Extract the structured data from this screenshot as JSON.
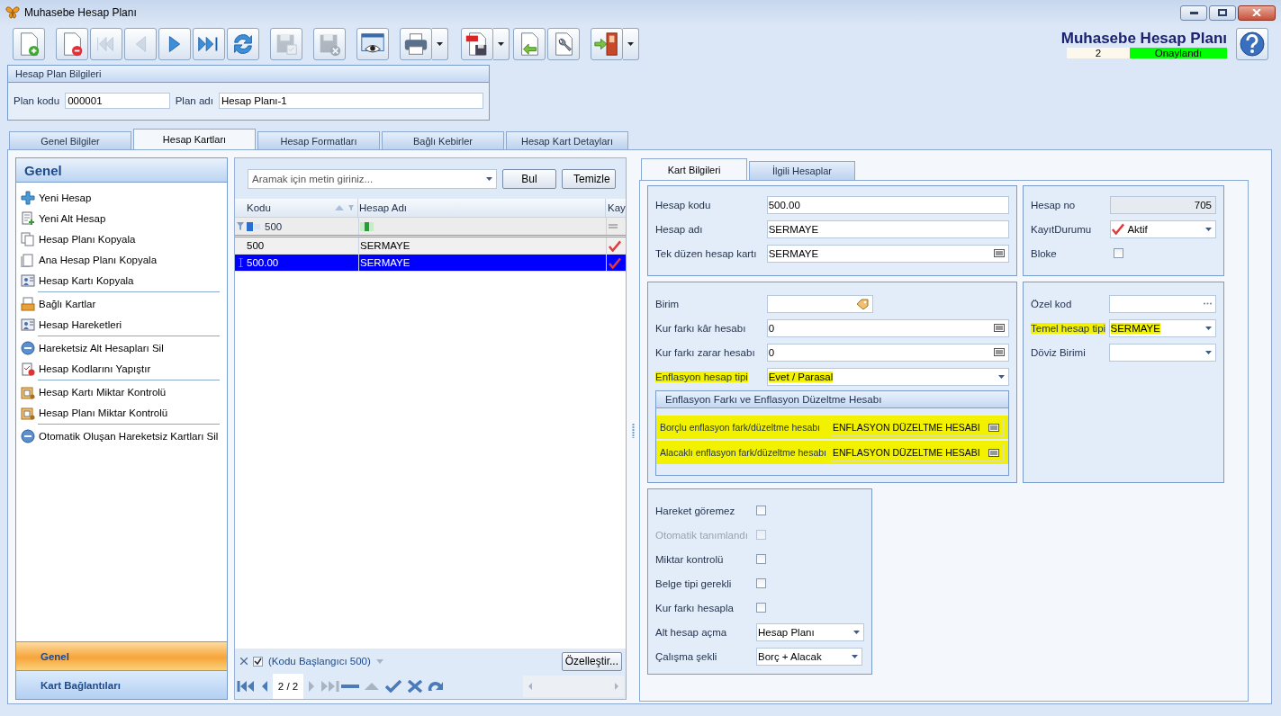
{
  "window": {
    "title": "Muhasebe Hesap Planı"
  },
  "toolbar": [
    {
      "kind": "new",
      "disabled": false
    },
    {
      "kind": "delete",
      "disabled": false
    },
    {
      "kind": "first",
      "disabled": true
    },
    {
      "kind": "prev",
      "disabled": true
    },
    {
      "kind": "next",
      "disabled": false
    },
    {
      "kind": "last",
      "disabled": false
    },
    {
      "kind": "refresh",
      "disabled": false
    },
    {
      "kind": "save",
      "disabled": true
    },
    {
      "kind": "cancel",
      "disabled": true
    },
    {
      "kind": "preview",
      "disabled": false
    },
    {
      "kind": "print",
      "disabled": false
    },
    {
      "kind": "pdf",
      "disabled": false
    },
    {
      "kind": "import",
      "disabled": false
    },
    {
      "kind": "tools",
      "disabled": false
    },
    {
      "kind": "exit",
      "disabled": false
    }
  ],
  "header": {
    "title": "Muhasebe Hesap Planı",
    "number": "2",
    "status": "Onaylandı"
  },
  "plan_info": {
    "title": "Hesap Plan Bilgileri",
    "fields": [
      {
        "label": "Plan kodu",
        "value": "000001"
      },
      {
        "label": "Plan adı",
        "value": "Hesap Planı-1"
      }
    ]
  },
  "tabs": [
    {
      "label": "Genel Bilgiler",
      "selected": false
    },
    {
      "label": "Hesap Kartları",
      "selected": true
    },
    {
      "label": "Hesap Formatları",
      "selected": false
    },
    {
      "label": "Bağlı Kebirler",
      "selected": false
    },
    {
      "label": "Hesap Kart Detayları",
      "selected": false
    }
  ],
  "sidebar": {
    "title": "Genel",
    "groups": [
      [
        {
          "label": "Yeni Hesap",
          "kind": "plus"
        },
        {
          "label": "Yeni Alt Hesap",
          "kind": "docplus"
        },
        {
          "label": "Hesap Planı Kopyala",
          "kind": "copy"
        },
        {
          "label": "Ana Hesap Planı Kopyala",
          "kind": "page"
        },
        {
          "label": "Hesap Kartı Kopyala",
          "kind": "card"
        }
      ],
      [
        {
          "label": "Bağlı Kartlar",
          "kind": "tray"
        },
        {
          "label": "Hesap Hareketleri",
          "kind": "card"
        }
      ],
      [
        {
          "label": "Hareketsiz Alt Hesapları Sil",
          "kind": "minus"
        },
        {
          "label": "Hesap Kodlarını Yapıştır",
          "kind": "clipboard"
        }
      ],
      [
        {
          "label": "Hesap Kartı Miktar Kontrolü",
          "kind": "box"
        },
        {
          "label": "Hesap Planı Miktar Kontrolü",
          "kind": "box"
        }
      ],
      [
        {
          "label": "Otomatik Oluşan Hareketsiz Kartları Sil",
          "kind": "minus"
        }
      ]
    ],
    "sections": [
      {
        "label": "Genel",
        "selected": true
      },
      {
        "label": "Kart Bağlantıları",
        "selected": false
      }
    ]
  },
  "grid": {
    "search": {
      "placeholder": "Aramak için metin giriniz..."
    },
    "buttons": [
      "Bul",
      "Temizle"
    ],
    "columns": [
      "Kodu",
      "Hesap Adı",
      "Kay"
    ],
    "filter": {
      "value": "500"
    },
    "rows": [
      {
        "cells": [
          "500",
          "SERMAYE"
        ],
        "checked": true,
        "selected": false
      },
      {
        "cells": [
          "500.00",
          "SERMAYE"
        ],
        "checked": true,
        "selected": true
      }
    ],
    "filter_bar": {
      "enabled": true,
      "text": "(Kodu Başlangıcı 500)"
    },
    "customize": "Özelleştir...",
    "navigator": {
      "position": "2 / 2"
    }
  },
  "detail": {
    "tabs": [
      {
        "label": "Kart Bilgileri",
        "selected": true
      },
      {
        "label": "İlgili Hesaplar",
        "selected": false
      }
    ],
    "main_fields": [
      {
        "label": "Hesap kodu",
        "value": "500.00",
        "kind": "text"
      },
      {
        "label": "Hesap adı",
        "value": "SERMAYE",
        "kind": "text"
      },
      {
        "label": "Tek düzen hesap kartı",
        "value": "SERMAYE",
        "kind": "lookup"
      }
    ],
    "status_fields": [
      {
        "label": "Hesap no",
        "value": "705",
        "kind": "readonly"
      },
      {
        "label": "KayıtDurumu",
        "value": "Aktif",
        "kind": "status"
      },
      {
        "label": "Bloke",
        "kind": "checkbox",
        "checked": false
      }
    ],
    "currency_fields": [
      {
        "label": "Birim",
        "kind": "tag"
      },
      {
        "label": "Kur farkı kâr hesabı",
        "value": "0",
        "kind": "lookup"
      },
      {
        "label": "Kur farkı zarar hesabı",
        "value": "0",
        "kind": "lookup"
      },
      {
        "label": "Enflasyon hesap tipi",
        "value": "Evet / Parasal",
        "kind": "dropdown",
        "highlighted": true
      }
    ],
    "inflation": {
      "title": "Enflasyon Farkı ve Enflasyon Düzeltme Hesabı",
      "fields": [
        {
          "label": "Borçlu enflasyon fark/düzeltme hesabı",
          "value": "ENFLASYON DÜZELTME HESABI",
          "kind": "lookup",
          "highlighted": true
        },
        {
          "label": "Alacaklı enflasyon fark/düzeltme hesabı",
          "value": "ENFLASYON DÜZELTME HESABI",
          "kind": "lookup",
          "highlighted": true
        }
      ]
    },
    "code_fields": [
      {
        "label": "Özel kod",
        "kind": "ellipsis"
      },
      {
        "label": "Temel hesap tipi",
        "value": "SERMAYE",
        "kind": "dropdown",
        "highlighted": true
      },
      {
        "label": "Döviz Birimi",
        "kind": "dropdown"
      }
    ],
    "options": [
      {
        "label": "Hareket göremez",
        "kind": "checkbox",
        "checked": false,
        "disabled": false
      },
      {
        "label": "Otomatik tanımlandı",
        "kind": "checkbox",
        "checked": false,
        "disabled": true
      },
      {
        "label": "Miktar kontrolü",
        "kind": "checkbox",
        "checked": false,
        "disabled": false
      },
      {
        "label": "Belge tipi gerekli",
        "kind": "checkbox",
        "checked": false,
        "disabled": false
      },
      {
        "label": "Kur farkı hesapla",
        "kind": "checkbox",
        "checked": false,
        "disabled": false
      },
      {
        "label": "Alt hesap açma",
        "kind": "dropdown",
        "value": "Hesap Planı"
      },
      {
        "label": "Çalışma şekli",
        "kind": "dropdown",
        "value": "Borç + Alacak"
      }
    ]
  }
}
